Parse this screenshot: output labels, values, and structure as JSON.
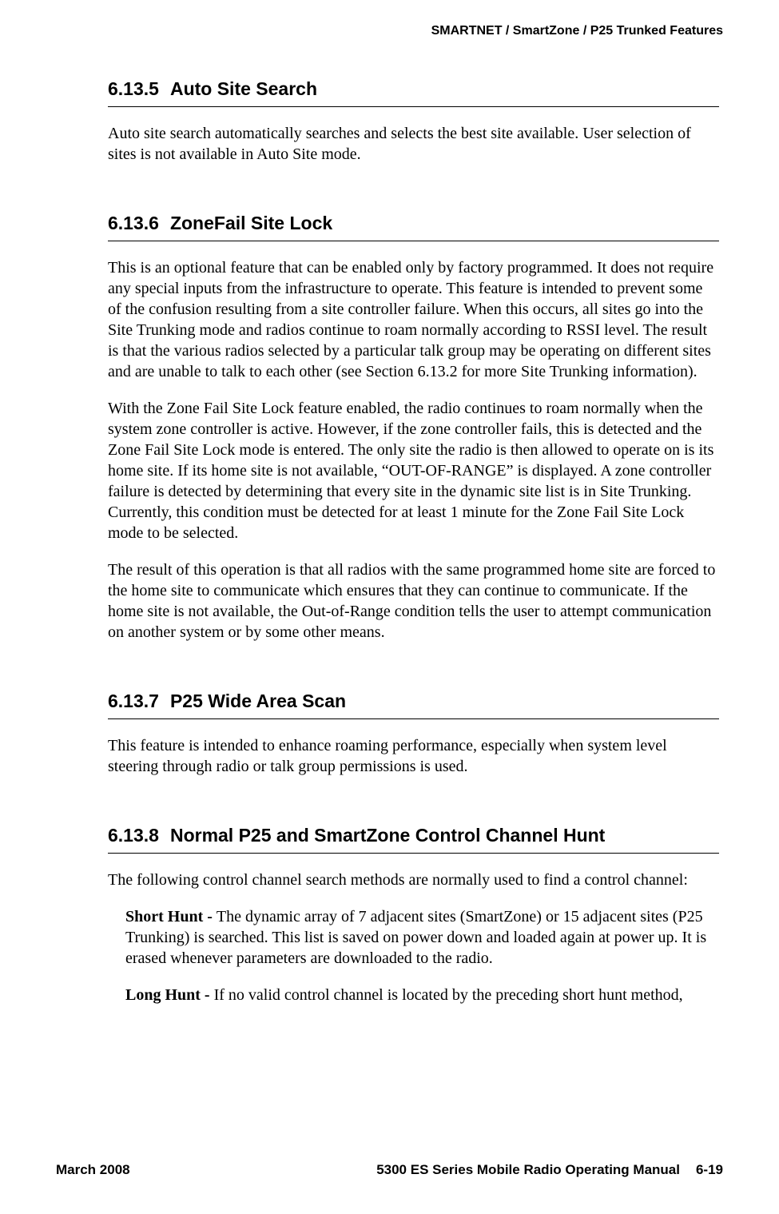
{
  "header": {
    "title": "SMARTNET / SmartZone / P25 Trunked Features"
  },
  "sections": {
    "s6135": {
      "number": "6.13.5",
      "title": "Auto Site Search",
      "p1": "Auto site search automatically searches and selects the best site available. User selection of sites is not available in Auto Site mode."
    },
    "s6136": {
      "number": "6.13.6",
      "title": "ZoneFail Site Lock",
      "p1": "This is an optional feature that can be enabled only by factory programmed. It does not require any special inputs from the infrastructure to operate. This feature is intended to prevent some of the confusion resulting from a site controller failure. When this occurs, all sites go into the Site Trunking mode and radios continue to roam normally according to RSSI level. The result is that the various radios selected by a particular talk group may be operating on different sites and are unable to talk to each other (see Section 6.13.2 for more Site Trunking information).",
      "p2": "With the Zone Fail Site Lock feature enabled, the radio continues to roam normally when the system zone controller is active. However, if the zone controller fails, this is detected and the Zone Fail Site Lock mode is entered. The only site the radio is then allowed to operate on is its home site. If its home site is not available, “OUT-OF-RANGE” is displayed. A zone controller failure is detected by determining that every site in the dynamic site list is in Site Trunking. Currently, this condition must be detected for at least 1 minute for the Zone Fail Site Lock mode to be selected.",
      "p3": "The result of this operation is that all radios with the same programmed home site are forced to the home site to communicate which ensures that they can continue to communicate. If the home site is not available, the Out-of-Range condition tells the user to attempt communication on another system or by some other means."
    },
    "s6137": {
      "number": "6.13.7",
      "title": "P25 Wide Area Scan",
      "p1": "This feature is intended to enhance roaming performance, especially when system level steering through radio or talk group permissions is used."
    },
    "s6138": {
      "number": "6.13.8",
      "title": "Normal P25 and SmartZone Control Channel Hunt",
      "p1": "The following control channel search methods are normally used to find a control channel:",
      "shortHuntLabel": "Short Hunt - ",
      "shortHuntText": "The dynamic array of 7 adjacent sites (SmartZone) or 15 adjacent sites (P25 Trunking) is searched. This list is saved on power down and loaded again at power up. It is erased whenever parameters are downloaded to the radio.",
      "longHuntLabel": "Long Hunt - ",
      "longHuntText": "If no valid control channel is located by the preceding short hunt method,"
    }
  },
  "footer": {
    "left": "March 2008",
    "manual": "5300 ES Series Mobile Radio Operating Manual",
    "page": "6-19"
  }
}
